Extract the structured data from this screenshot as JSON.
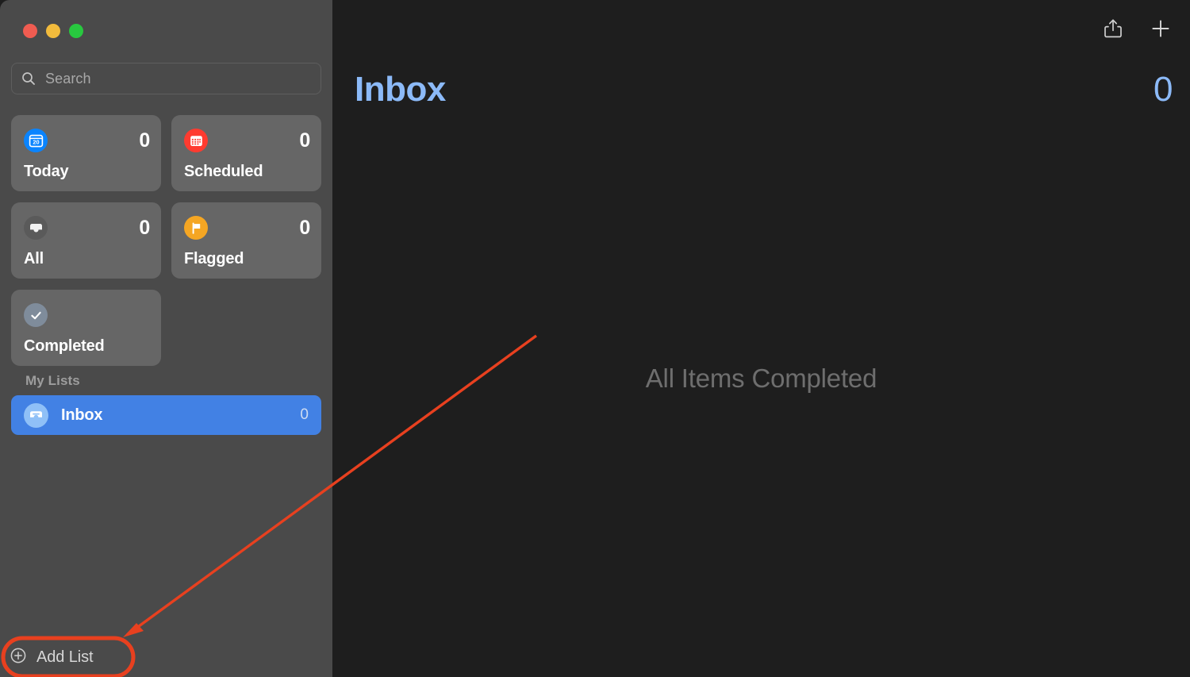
{
  "window": {
    "traffic_lights": [
      {
        "name": "close",
        "color": "#f05c51"
      },
      {
        "name": "minimize",
        "color": "#f2bb3c"
      },
      {
        "name": "maximize",
        "color": "#28c83f"
      }
    ]
  },
  "sidebar": {
    "search": {
      "placeholder": "Search",
      "value": "",
      "icon": "search-icon"
    },
    "smart_lists": [
      {
        "id": "today",
        "label": "Today",
        "count": "0",
        "icon": "calendar-day-icon",
        "icon_color": "#0a84ff",
        "icon_text": "20"
      },
      {
        "id": "scheduled",
        "label": "Scheduled",
        "count": "0",
        "icon": "calendar-icon",
        "icon_color": "#ff3b30"
      },
      {
        "id": "all",
        "label": "All",
        "count": "0",
        "icon": "inbox-tray-icon",
        "icon_color": "#5a5a5a"
      },
      {
        "id": "flagged",
        "label": "Flagged",
        "count": "0",
        "icon": "flag-icon",
        "icon_color": "#f5a623"
      },
      {
        "id": "completed",
        "label": "Completed",
        "count": "",
        "icon": "checkmark-icon",
        "icon_color": "#7f8c9b"
      }
    ],
    "my_lists": {
      "header": "My Lists",
      "items": [
        {
          "label": "Inbox",
          "count": "0",
          "icon": "inbox-icon",
          "selected": true,
          "accent": "#4281e4"
        }
      ]
    },
    "add_list": {
      "label": "Add List",
      "icon": "plus-circle-icon"
    }
  },
  "main": {
    "title": "Inbox",
    "count": "0",
    "accent": "#8cbaf8",
    "empty_state": "All Items Completed",
    "toolbar": [
      {
        "id": "share",
        "icon": "share-icon"
      },
      {
        "id": "new-reminder",
        "icon": "plus-icon"
      }
    ]
  },
  "annotation": {
    "highlight_color": "#e8401f",
    "target": "add-list"
  }
}
